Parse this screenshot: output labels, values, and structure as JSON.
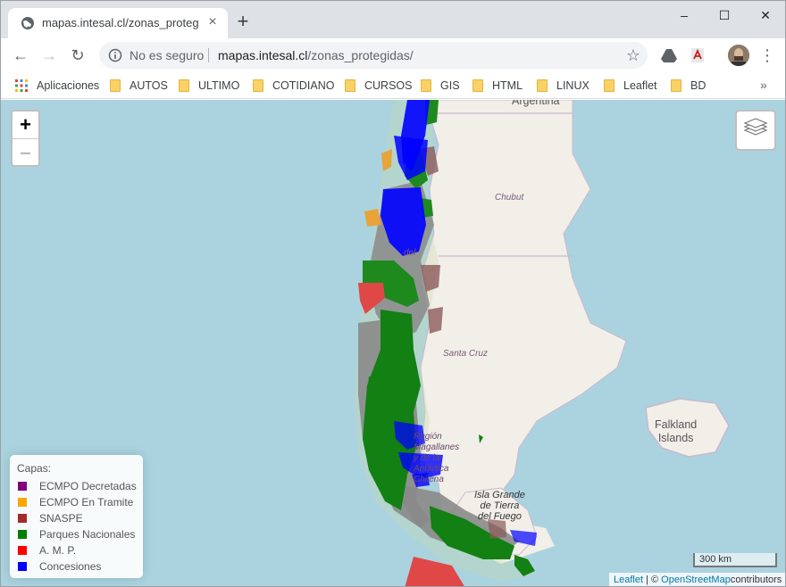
{
  "browser": {
    "tab_title": "mapas.intesal.cl/zonas_protegidas/",
    "tab_close": "×",
    "new_tab": "+",
    "security_label": "No es seguro",
    "url_host": "mapas.intesal.cl",
    "url_path": "/zonas_protegidas/",
    "window_controls": {
      "minimize": "–",
      "maximize": "☐",
      "close": "✕"
    }
  },
  "bookmarks": {
    "apps_label": "Aplicaciones",
    "folders": [
      "AUTOS",
      "ULTIMO",
      "COTIDIANO",
      "CURSOS",
      "GIS",
      "HTML",
      "LINUX",
      "Leaflet",
      "BD"
    ],
    "more": "»"
  },
  "map": {
    "labels": {
      "argentina": "Argentina",
      "chubut": "Chubut",
      "santa_cruz": "Santa Cruz",
      "falkland": [
        "Falkland",
        "Islands"
      ],
      "tierra_fuego": [
        "Isla Grande",
        "de Tierra",
        "del Fuego"
      ],
      "magallanes": [
        "Región",
        "Magallanes",
        "y de la",
        "Antártica",
        "Chilena"
      ],
      "aysen_fragment": "del"
    },
    "zoom_in": "+",
    "zoom_out": "–",
    "scale_label": "300 km",
    "attribution": {
      "leaflet": "Leaflet",
      "sep": " | © ",
      "osm": "OpenStreetMap",
      "suffix": "contributors"
    }
  },
  "legend": {
    "title": "Capas:",
    "items": [
      {
        "label": "ECMPO Decretadas",
        "color": "#800080"
      },
      {
        "label": "ECMPO En Tramite",
        "color": "#ffa500"
      },
      {
        "label": "SNASPE",
        "color": "#a52a2a"
      },
      {
        "label": "Parques Nacionales",
        "color": "#008000"
      },
      {
        "label": "A. M. P.",
        "color": "#ff0000"
      },
      {
        "label": "Concesiones",
        "color": "#0000ff"
      }
    ]
  }
}
